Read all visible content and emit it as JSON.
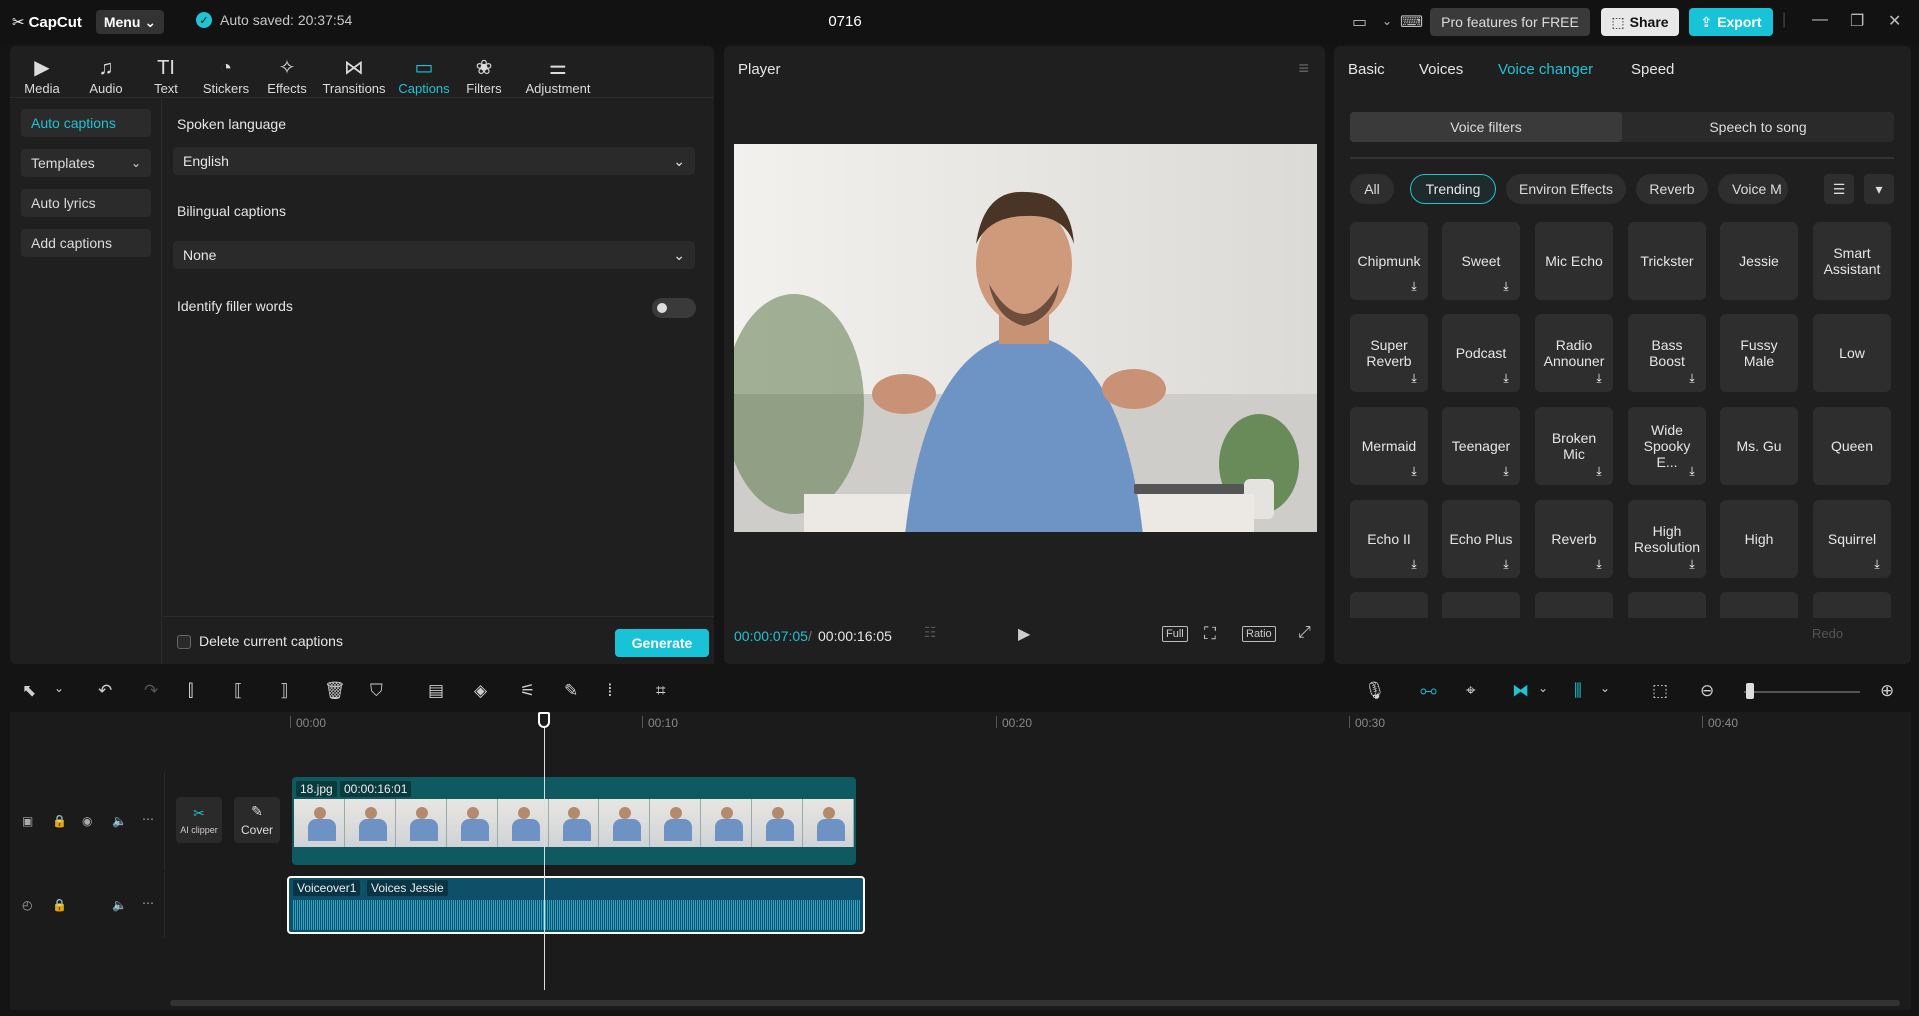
{
  "app": {
    "logo": "CapCut",
    "menu_label": "Menu",
    "autosave": "Auto saved: 20:37:54",
    "title": "0716"
  },
  "topbar": {
    "pro_label": "Pro features for FREE",
    "share_label": "Share",
    "export_label": "Export"
  },
  "tools": [
    {
      "label": "Media",
      "icon": "▶"
    },
    {
      "label": "Audio",
      "icon": "♫"
    },
    {
      "label": "Text",
      "icon": "TI"
    },
    {
      "label": "Stickers",
      "icon": "◔"
    },
    {
      "label": "Effects",
      "icon": "✧"
    },
    {
      "label": "Transitions",
      "icon": "⋈"
    },
    {
      "label": "Captions",
      "icon": "▭"
    },
    {
      "label": "Filters",
      "icon": "❀"
    },
    {
      "label": "Adjustment",
      "icon": "⚌"
    }
  ],
  "captions": {
    "side": [
      "Auto captions",
      "Templates",
      "Auto lyrics",
      "Add captions"
    ],
    "spoken_language_label": "Spoken language",
    "spoken_language_value": "English",
    "bilingual_label": "Bilingual captions",
    "bilingual_value": "None",
    "filler_label": "Identify filler words",
    "delete_label": "Delete current captions",
    "generate_label": "Generate"
  },
  "player": {
    "title": "Player",
    "current_time": "00:00:07:05",
    "duration": "00:00:16:05",
    "full": "Full",
    "ratio": "Ratio"
  },
  "right": {
    "tabs": [
      "Basic",
      "Voices",
      "Voice changer",
      "Speed"
    ],
    "segments": [
      "Voice filters",
      "Speech to song"
    ],
    "chips": [
      "All",
      "Trending",
      "Environ Effects",
      "Reverb",
      "Voice M"
    ],
    "filters": [
      {
        "name": "Chipmunk",
        "dl": true
      },
      {
        "name": "Sweet",
        "dl": true
      },
      {
        "name": "Mic Echo",
        "dl": false
      },
      {
        "name": "Trickster",
        "dl": false
      },
      {
        "name": "Jessie",
        "dl": false
      },
      {
        "name": "Smart Assistant",
        "dl": false
      },
      {
        "name": "Super Reverb",
        "dl": true
      },
      {
        "name": "Podcast",
        "dl": true
      },
      {
        "name": "Radio Announer",
        "dl": true
      },
      {
        "name": "Bass Boost",
        "dl": true
      },
      {
        "name": "Fussy Male",
        "dl": false
      },
      {
        "name": "Low",
        "dl": false
      },
      {
        "name": "Mermaid",
        "dl": true
      },
      {
        "name": "Teenager",
        "dl": true
      },
      {
        "name": "Broken Mic",
        "dl": true
      },
      {
        "name": "Wide Spooky E...",
        "dl": true
      },
      {
        "name": "Ms. Gu",
        "dl": false
      },
      {
        "name": "Queen",
        "dl": false
      },
      {
        "name": "Echo II",
        "dl": true
      },
      {
        "name": "Echo Plus",
        "dl": true
      },
      {
        "name": "Reverb",
        "dl": true
      },
      {
        "name": "High Resolution",
        "dl": true
      },
      {
        "name": "High",
        "dl": false
      },
      {
        "name": "Squirrel",
        "dl": true
      },
      {
        "name": "",
        "dl": false
      },
      {
        "name": "",
        "dl": false
      },
      {
        "name": "",
        "dl": false
      },
      {
        "name": "",
        "dl": false
      },
      {
        "name": "",
        "dl": false
      },
      {
        "name": "",
        "dl": false
      }
    ],
    "redo_label": "Redo"
  },
  "timeline": {
    "ruler": [
      "00:00",
      "00:10",
      "00:20",
      "00:30",
      "00:40"
    ],
    "ai_clipper": "AI clipper",
    "cover": "Cover",
    "video_clip": {
      "name": "18.jpg",
      "duration": "00:00:16:01"
    },
    "audio_clip": {
      "name": "Voiceover1",
      "effect": "Voices Jessie"
    }
  }
}
